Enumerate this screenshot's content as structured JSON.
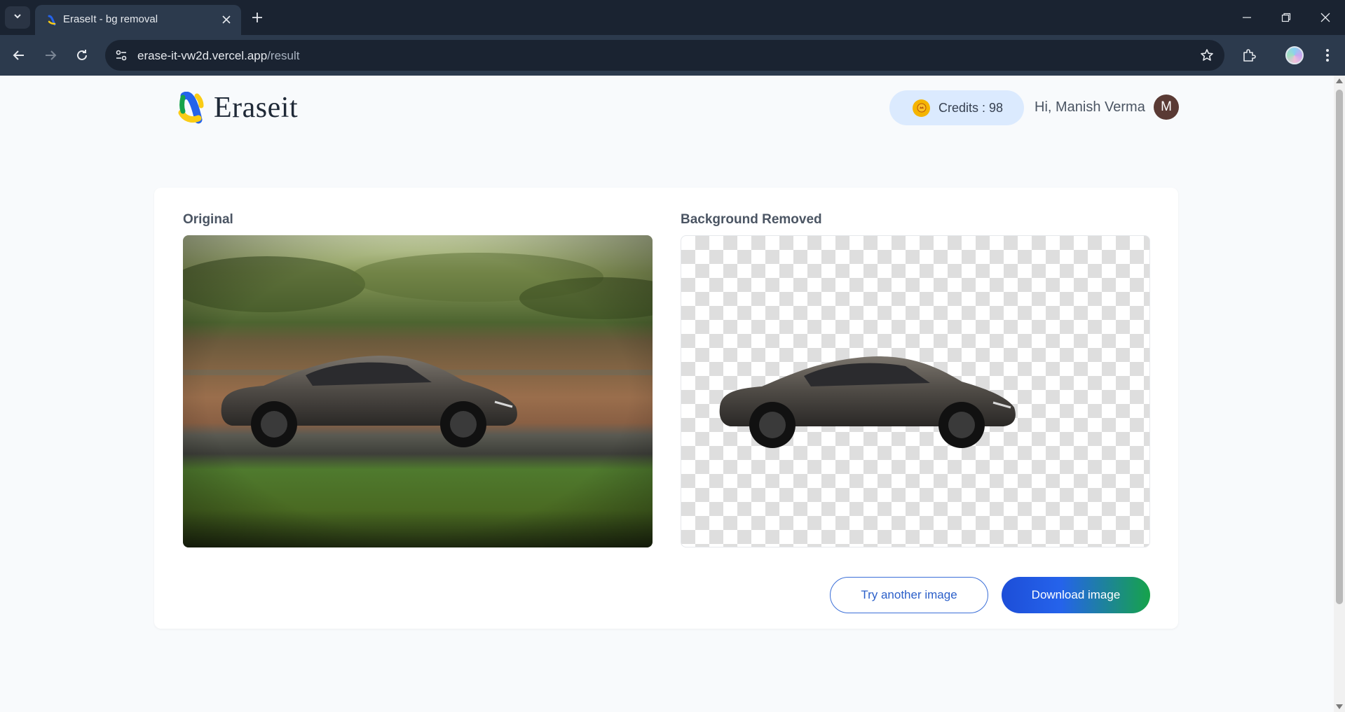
{
  "browser": {
    "tab_title": "EraseIt - bg removal",
    "url_host": "erase-it-vw2d.vercel.app",
    "url_path": "/result"
  },
  "header": {
    "logo_text": "Eraseit",
    "credits_label": "Credits : 98",
    "greeting": "Hi, Manish Verma",
    "avatar_initial": "M"
  },
  "result": {
    "original_title": "Original",
    "removed_title": "Background Removed"
  },
  "actions": {
    "try_another": "Try another image",
    "download": "Download image"
  },
  "colors": {
    "primary_blue": "#1d4ed8",
    "accent_green": "#16a34a",
    "credits_bg": "#dbeafe",
    "chrome_dark": "#1a2331"
  }
}
